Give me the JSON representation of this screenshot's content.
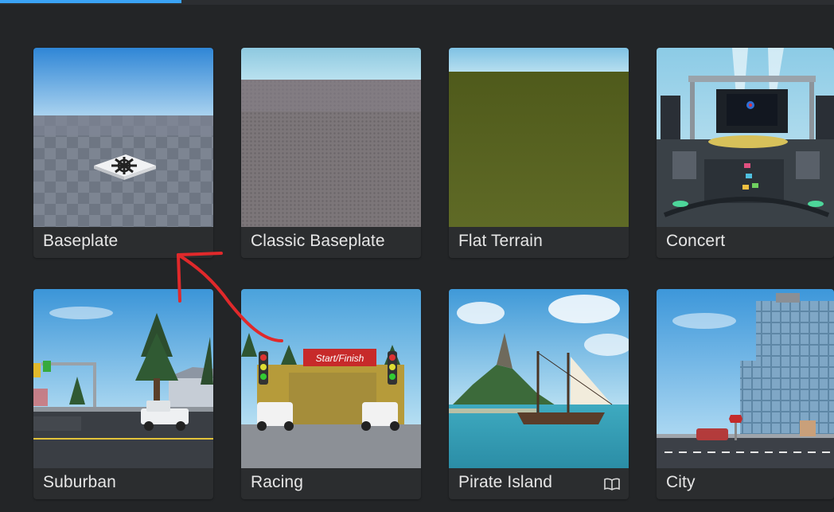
{
  "templates": [
    {
      "label": "Baseplate",
      "thumbnail": "baseplate-thumbnail"
    },
    {
      "label": "Classic Baseplate",
      "thumbnail": "classic-baseplate-thumbnail"
    },
    {
      "label": "Flat Terrain",
      "thumbnail": "flat-terrain-thumbnail"
    },
    {
      "label": "Concert",
      "thumbnail": "concert-thumbnail"
    },
    {
      "label": "Suburban",
      "thumbnail": "suburban-thumbnail"
    },
    {
      "label": "Racing",
      "thumbnail": "racing-thumbnail"
    },
    {
      "label": "Pirate Island",
      "thumbnail": "pirate-island-thumbnail",
      "icon": "book-icon"
    },
    {
      "label": "City",
      "thumbnail": "city-thumbnail"
    }
  ],
  "racing_sign": "Start/Finish",
  "colors": {
    "background": "#232527",
    "card": "#2b2d2f",
    "label": "#e6e6e6",
    "tab_indicator": "#3aa3f6",
    "annotation_arrow": "#e0292b"
  }
}
